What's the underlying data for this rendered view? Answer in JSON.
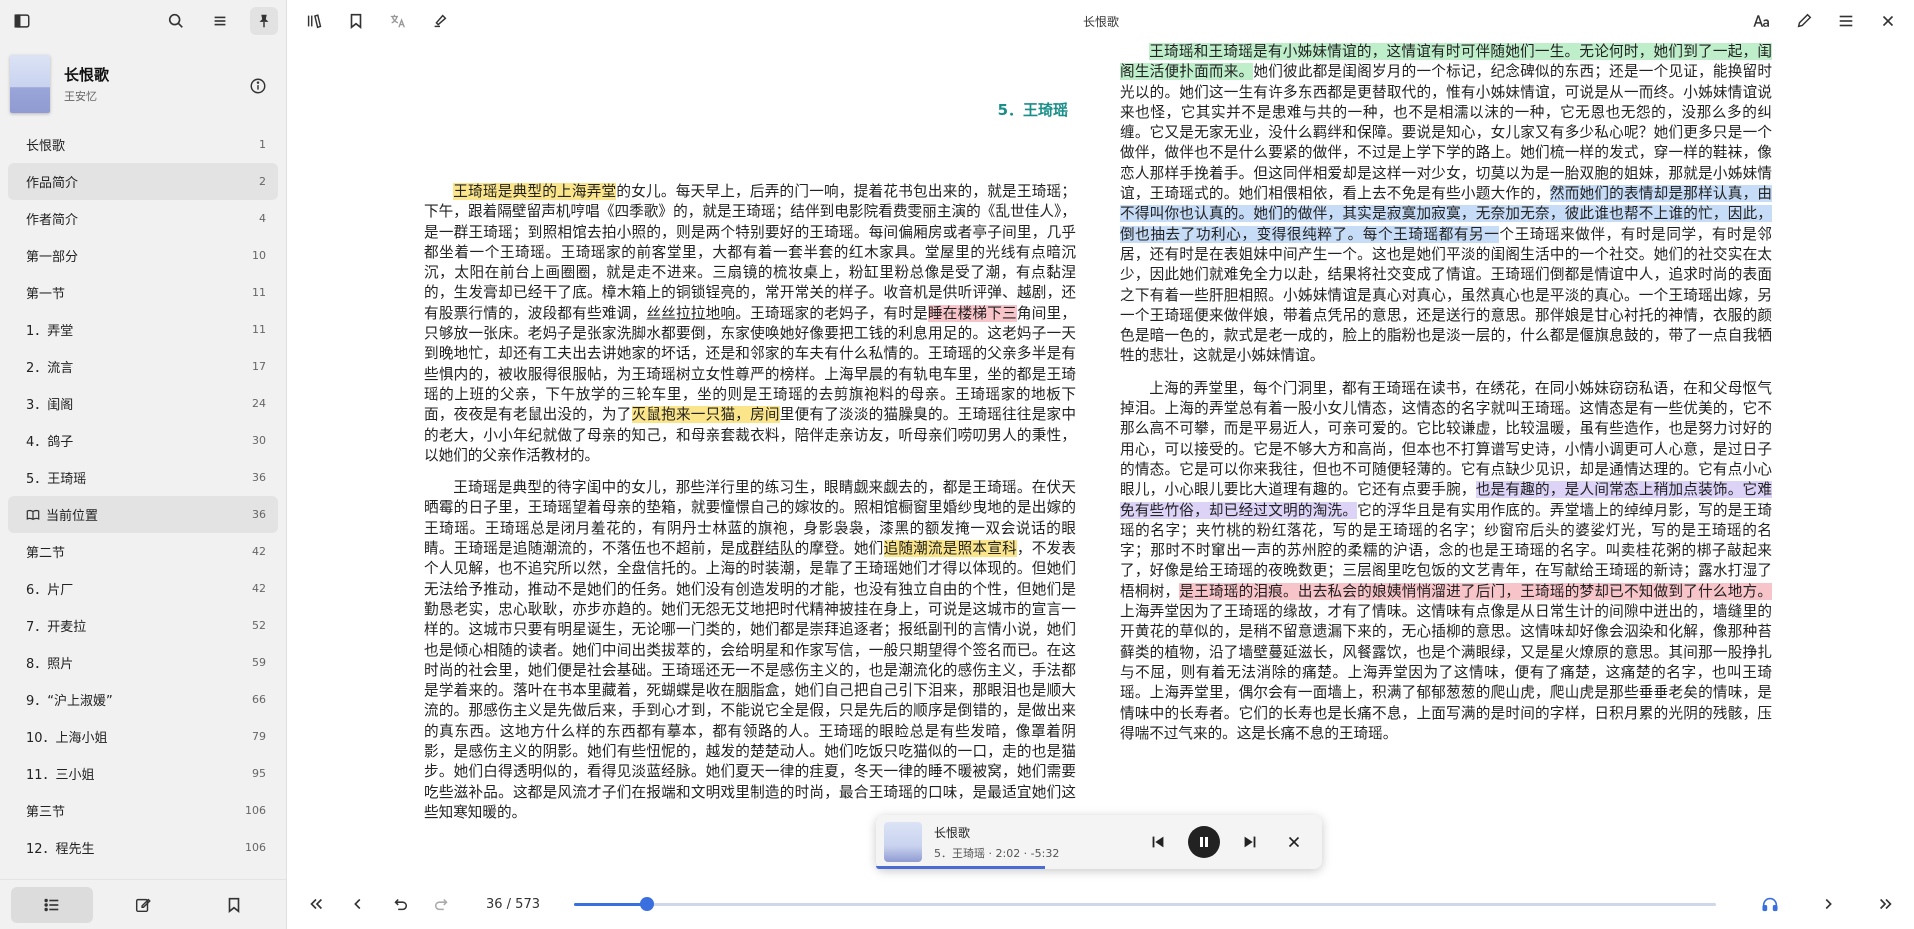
{
  "window": {
    "title": "长恨歌"
  },
  "book": {
    "title": "长恨歌",
    "author": "王安忆"
  },
  "toc": [
    {
      "label": "长恨歌",
      "page": "1",
      "level": 0
    },
    {
      "label": "作品简介",
      "page": "2",
      "level": 0,
      "selected": true
    },
    {
      "label": "作者简介",
      "page": "4",
      "level": 0
    },
    {
      "label": "第一部分",
      "page": "10",
      "level": 0
    },
    {
      "label": "第一节",
      "page": "11",
      "level": 0
    },
    {
      "label": "1．弄堂",
      "page": "11",
      "level": 1
    },
    {
      "label": "2．流言",
      "page": "17",
      "level": 1
    },
    {
      "label": "3．闺阁",
      "page": "24",
      "level": 1
    },
    {
      "label": "4．鸽子",
      "page": "30",
      "level": 1
    },
    {
      "label": "5．王琦瑶",
      "page": "36",
      "level": 1
    },
    {
      "label": "当前位置",
      "page": "36",
      "level": 1,
      "current": true
    },
    {
      "label": "第二节",
      "page": "42",
      "level": 0
    },
    {
      "label": "6．片厂",
      "page": "42",
      "level": 1
    },
    {
      "label": "7．开麦拉",
      "page": "52",
      "level": 1
    },
    {
      "label": "8．照片",
      "page": "59",
      "level": 1
    },
    {
      "label": "9．“沪上淑媛”",
      "page": "66",
      "level": 1
    },
    {
      "label": "10．上海小姐",
      "page": "79",
      "level": 1
    },
    {
      "label": "11．三小姐",
      "page": "95",
      "level": 1
    },
    {
      "label": "第三节",
      "page": "106",
      "level": 0
    },
    {
      "label": "12．程先生",
      "page": "106",
      "level": 1
    }
  ],
  "chapter_title": "5．王琦瑶",
  "left_paragraphs": [
    [
      {
        "t": "王琦瑶是典型的上海弄堂",
        "c": "hl-yellow"
      },
      {
        "t": "的女儿。每天早上，后弄的门一响，提着花书包出来的，就是王琦瑶；下午，跟着隔壁留声机哼唱《四季歌》的，就是王琦瑶；结伴到电影院看费雯丽主演的《乱世佳人》，是一群王琦瑶；到照相馆去拍小照的，则是两个特别要好的王琦瑶。每间偏厢房或者亭子间里，几乎都坐着一个王琦瑶。王琦瑶家的前客堂里，大都有着一套半套的红木家具。堂屋里的光线有点暗沉沉，太阳在前台上画圈圈，就是走不进来。三扇镜的梳妆桌上，粉缸里粉总像是受了潮，有点黏涅的，生发膏却已经干了底。樟木箱上的铜锁锃亮的，常开常关的样子。收音机是供听评弹、越剧，还有股票行情的，波段都有些难调，"
      },
      {
        "t": "丝丝拉拉地响",
        "c": "ul"
      },
      {
        "t": "。王琦瑶家的老妈子，有时是"
      },
      {
        "t": "睡在楼梯下三",
        "c": "hl-red"
      },
      {
        "t": "角间里，只够放一张床。老妈子是张家洗脚水都要倒，东家使唤她好像要把工钱的利息用足的。这老妈子一天到晚地忙，却还有工夫出去讲她家的坏话，还是和邻家的车夫有什么私情的。王琦瑶的父亲多半是有些惧内的，被收服得很服帖，为王琦瑶树立女性尊严的榜样。上海早晨的有轨电车里，坐的都是王琦瑶的上班的父亲，下午放学的三轮车里，坐的则是王琦瑶的去剪旗袍料的母亲。王琦瑶家的地板下面，夜夜是有老鼠出没的，为了"
      },
      {
        "t": "灭鼠抱来一只猫，房间",
        "c": "hl-yellow"
      },
      {
        "t": "里便有了淡淡的猫臊臭的。王琦瑶往往是家中的老大，小小年纪就做了母亲的知己，和母亲套裁衣料，陪伴走亲访友，听母亲们唠叨男人的秉性，以她们的父亲作活教材的。"
      }
    ],
    [
      {
        "t": "王琦瑶是典型的待字闺中的女儿，那些洋行里的练习生，眼睛觑来觑去的，都是王琦瑶。在伏天晒霉的日子里，王琦瑶望着母亲的垫箱，就要憧憬自己的嫁妆的。照相馆橱窗里婚纱曳地的是出嫁的王琦瑶。王琦瑶总是闭月羞花的，有阴丹士林蓝的旗袍，身影袅袅，漆黑的额发掩一双会说话的眼睛。王琦瑶是追随潮流的，不落伍也不超前，是"
      },
      {
        "t": "成群结队",
        "c": "ul"
      },
      {
        "t": "的摩登。她们"
      },
      {
        "t": "追随潮流是照本宣科",
        "c": "hl-yellow"
      },
      {
        "t": "，不发表个人见解，也不追究所以然，全盘信托的。上海的时装潮，是靠了王琦瑶她们才得以体现的。但她们无法给予推动，推动不是她们的任务。她们没有创造发明的才能，也没有独立自由的个性，但她们是勤恳老实，忠心耿耿，亦步亦趋的。她们无怨无艾地把时代精神披挂在身上，可说是这城市的宣言一样的。这城市只要有明星诞生，无论哪一门类的，她们都是崇拜追逐者；报纸副刊的言情小说，她们也是倾心相随的读者。她们中间出类拔萃的，会给明星和作家写信，一般只期望得个签名而已。在这时尚的社会里，她们便是社会基础。王琦瑶还无一不是感伤主义的，也是潮流化的感伤主义，手法都是学着来的。落叶在书本里藏着，死蝴蝶是收在胭脂盒，她们自己把自己引下泪来，那眼泪也是顺大流的。那感伤主义是先做后来，手到心才到，不能说它全是假，只是先后的顺序是倒错的，是做出来的真东西。这地方什么样的东西都有摹本，都有领路的人。王琦瑶的眼睑总是有些发暗，像罩着阴影，是感伤主义的阴影。她们有些忸怩的，越发的楚楚动人。她们吃饭只吃猫似的一口，走的也是猫步。她们白得透明似的，看得见淡蓝经脉。她们夏天一律的疰夏，冬天一律的睡不暖被窝，她们需要吃些滋补品。这都是风流才子们在报端和文明戏里制造的时尚，最合王琦瑶的口味，是最适宜她们这些知寒知暖的。"
      }
    ]
  ],
  "right_paragraphs": [
    [
      {
        "t": "王琦瑶和王琦瑶是有小姊妹情谊的，这情谊有时可伴随她们一生。无论何时，她们到了一起，闺阁生活便扑面而来。",
        "c": "hl-green"
      },
      {
        "t": "她们彼此都是闺阁岁月的一个标记，纪念碑似的东西；还是一个见证，能换留时光以的。她们这一生有许多东西都是更替取代的，惟有小姊妹情谊，可说是从一而终。小姊妹情谊说来也怪，它其实并不是患难与共的一种，也不是相濡以沫的一种，它无恩也无怨的，没那么多的纠缠。它又是无家无业，没什么羁绊和保障。要说是知心，女儿家又有多少私心呢？她们更多只是一个做伴，做伴也不是什么要紧的做伴，不过是上学下学的路上。她们梳一样的发式，穿一样的鞋袜，像恋人那样手挽着手。但这同伴相爱却是这样一对少女，切莫以为是一胎双胞的姐妹，那就是小姊妹情谊，王琦瑶式的。她们相偎相依，看上去不免是有些小题大作的，"
      },
      {
        "t": "然而她们的表情却是那样认真，由不得叫你也认真的。她们的做伴，其实是寂寞加寂寞，无奈加无奈，彼此谁也帮不上谁的忙，因此，倒也抽去了功利心，变得很纯粹了。每个王琦瑶都有另一",
        "c": "hl-blue"
      },
      {
        "t": "个王琦瑶来做伴，有时是同学，有时是邻居，还有时是在表姐妹中间产生一个。这也是她们平淡的闺阁生活中的一个社交。她们的社交实在太少，因此她们就难免全力以赴，结果将社交变成了情谊。王琦瑶们倒都是情谊中人，追求时尚的表面之下有着一些肝胆相照。小姊妹情谊是真心对真心，虽然真心也是平淡的真心。一个王琦瑶出嫁，另一个王琦瑶便来做伴娘，带着点凭吊的意思，还是送行的意思。那伴娘是甘心衬托的神情，衣服的颜色是暗一色的，款式是老一成的，脸上的脂粉也是淡一层的，什么都是偃旗息鼓的，带了一点自我牺牲的悲壮，这就是小姊妹情谊。"
      }
    ],
    [
      {
        "t": "上海的弄堂里，每个门洞里，都有王琦瑶在读书，在绣花，在同小姊妹窃窃私语，在和父母怄气掉泪。上海的弄堂总有着一股小女儿情态，这情态的名字就叫王琦瑶。这情态是有一些优美的，它不那么高不可攀，而是平易近人，可亲可爱的。它比较谦虚，比较温暖，虽有些造作，也是努力讨好的用心，可以接受的。它是不够大方和高尚，但本也不打算谱写史诗，小情小调更可人心意，是过日子的情态。它是可以你来我往，但也不可随便轻薄的。它有点缺少见识，却是通情达理的。它有点小心眼儿，小心眼儿要比大道理有趣的。它还有点要手腕，"
      },
      {
        "t": "也是有趣的，是人间常态上稍加点装饰。它难免有些竹俗，却已经过文明的淘洗。",
        "c": "hl-purple"
      },
      {
        "t": "它的浮华且是有实用作底的。弄堂墙上的绰绰月影，写的是王琦瑶的名字；夹竹桃的粉红落花，写的是王琦瑶的名字；纱窗帘后头的婆娑灯光，写的是王琦瑶的名字；那时不时窜出一声的苏州腔的柔糯的沪语，念的也是王琦瑶的名字。叫卖桂花粥的梆子敲起来了，好像是给王琦瑶的夜晚数更；三层阁里吃包饭的文艺青年，在写献给王琦瑶的新诗；露水打湿了梧桐树，"
      },
      {
        "t": "是王琦瑶的泪痕。出去私会的娘姨悄悄溜进了后门，王琦瑶的梦却已不知做到了什么地方。",
        "c": "hl-red"
      },
      {
        "t": "上海弄堂因为了王琦瑶的缘故，才有了情味。这情味有点像是从日常生计的间隙中迸出的，墙缝里的开黄花的草似的，是稍不留意遗漏下来的，无心插柳的意思。这情味却好像会泅染和化解，像那种苔藓类的植物，沿了墙壁蔓延滋长，风餐露饮，也是个满眼绿，又是星火燎原的意思。其间那一股挣扎与不屈，则有着无法消除的痛楚。上海弄堂因为了这情味，便有了痛楚，这痛楚的名字，也叫王琦瑶。上海弄堂里，偶尔会有一面墙上，积满了郁郁葱葱的爬山虎，爬山虎是那些垂垂老矣的情味，是情味中的长寿者。它们的长寿也是长痛不息，上面写满的是时间的字样，日积月累的光阴的残骸，压得喘不过气来的。这是长痛不息的王琦瑶。"
      }
    ]
  ],
  "player": {
    "title": "长恨歌",
    "subtitle": "5．王琦瑶 · 2:02 · -5:32",
    "progress_pct": 38
  },
  "footer": {
    "page_info": "36 / 573",
    "progress": 0.064
  },
  "accent": "#3a6fe0",
  "chapter_color": "#1a8f8a"
}
